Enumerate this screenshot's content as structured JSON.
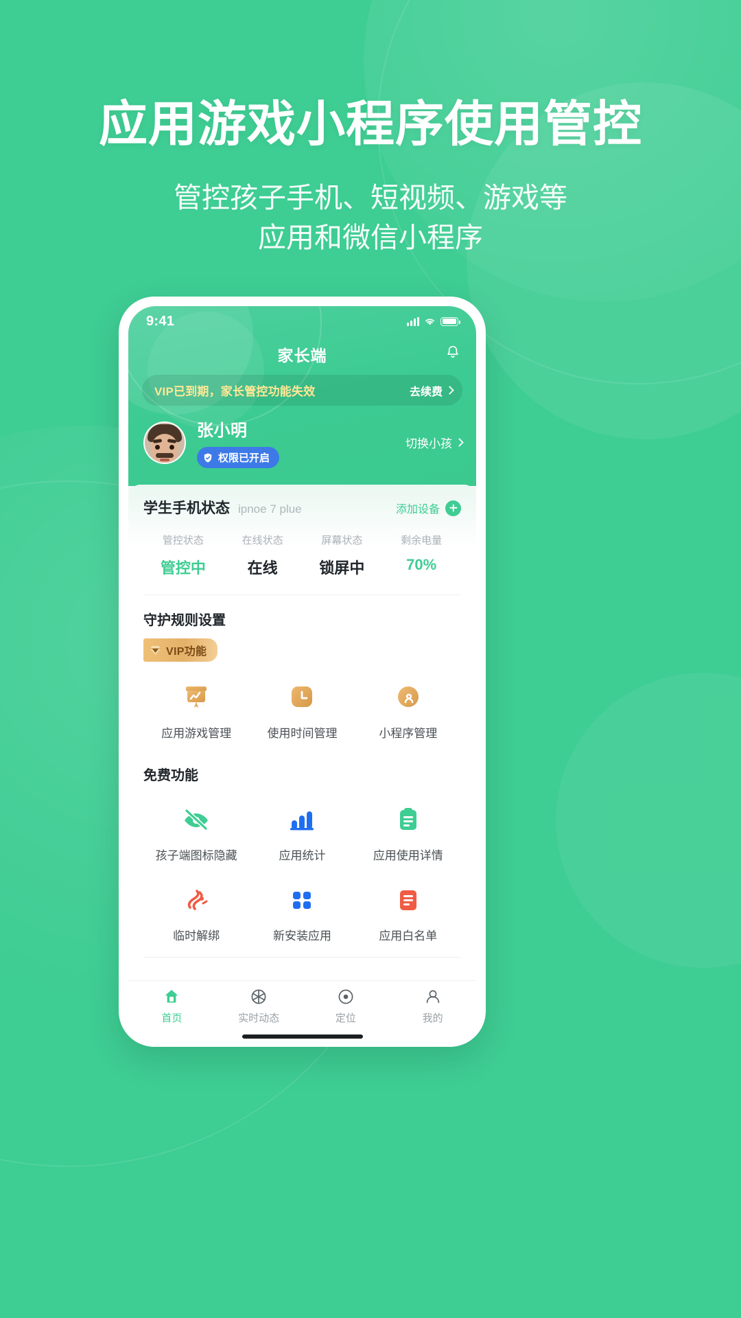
{
  "theme": {
    "brand_green": "#3ecd93",
    "page_background": "#3ecd93",
    "vip_gold": "#e5b169",
    "vip_banner_text_color": "#ffe896",
    "permission_blue": "#3d7ae8"
  },
  "hero": {
    "title": "应用游戏小程序使用管控",
    "subtitle_line1": "管控孩子手机、短视频、游戏等",
    "subtitle_line2": "应用和微信小程序"
  },
  "phone": {
    "statusbar": {
      "time": "9:41",
      "signal_icon": "cellular-signal-icon",
      "wifi_icon": "wifi-icon",
      "battery_icon": "battery-full-icon"
    },
    "navbar": {
      "title": "家长端",
      "bell_icon": "notification-bell-icon"
    },
    "vip_banner": {
      "message": "VIP已到期，家长管控功能失效",
      "cta": "去续费",
      "chevron_icon": "chevron-right-icon"
    },
    "profile": {
      "avatar_icon": "child-avatar",
      "name": "张小明",
      "permission_badge": "权限已开启",
      "permission_icon": "shield-check-icon",
      "switch_child": "切换小孩",
      "switch_chevron_icon": "chevron-right-icon"
    },
    "device": {
      "title": "学生手机状态",
      "model": "ipnoe 7 plue",
      "add_device_label": "添加设备",
      "add_device_icon": "plus-circle-icon",
      "status": [
        {
          "label": "管控状态",
          "value": "管控中",
          "accent": true
        },
        {
          "label": "在线状态",
          "value": "在线",
          "accent": false
        },
        {
          "label": "屏幕状态",
          "value": "锁屏中",
          "accent": false
        },
        {
          "label": "剩余电量",
          "value": "70%",
          "accent": true
        }
      ]
    },
    "guard_rules": {
      "title": "守护规则设置",
      "vip_tag": "VIP功能",
      "vip_tag_icon": "diamond-icon",
      "items": [
        {
          "label": "应用游戏管理",
          "icon": "app-game-board-icon"
        },
        {
          "label": "使用时间管理",
          "icon": "clock-icon"
        },
        {
          "label": "小程序管理",
          "icon": "miniprogram-icon"
        }
      ]
    },
    "free_features": {
      "title": "免费功能",
      "items": [
        {
          "label": "孩子端图标隐藏",
          "icon": "eye-off-icon"
        },
        {
          "label": "应用统计",
          "icon": "bar-chart-icon"
        },
        {
          "label": "应用使用详情",
          "icon": "clipboard-icon"
        },
        {
          "label": "临时解绑",
          "icon": "unbind-icon"
        },
        {
          "label": "新安装应用",
          "icon": "grid-dots-icon"
        },
        {
          "label": "应用白名单",
          "icon": "list-document-icon"
        }
      ]
    },
    "tabbar": {
      "items": [
        {
          "label": "首页",
          "icon": "home-icon",
          "active": true
        },
        {
          "label": "实时动态",
          "icon": "aperture-icon",
          "active": false
        },
        {
          "label": "定位",
          "icon": "location-target-icon",
          "active": false
        },
        {
          "label": "我的",
          "icon": "user-profile-icon",
          "active": false
        }
      ]
    }
  }
}
